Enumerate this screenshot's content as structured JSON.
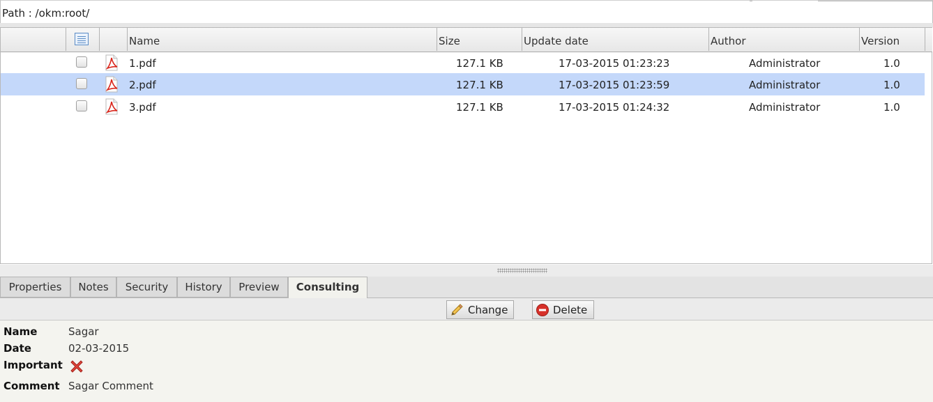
{
  "path": {
    "text": "Path : /okm:root/"
  },
  "columns": {
    "name": "Name",
    "size": "Size",
    "update_date": "Update date",
    "author": "Author",
    "version": "Version"
  },
  "icons": {
    "column_picker": "column-picker-icon",
    "pdf": "pdf-file-icon",
    "change": "pencil-icon",
    "delete": "delete-circle-icon",
    "important": "red-x-icon"
  },
  "files": [
    {
      "name": "1.pdf",
      "size": "127.1 KB",
      "date": "17-03-2015 01:23:23",
      "author": "Administrator",
      "version": "1.0",
      "selected": false
    },
    {
      "name": "2.pdf",
      "size": "127.1 KB",
      "date": "17-03-2015 01:23:59",
      "author": "Administrator",
      "version": "1.0",
      "selected": true
    },
    {
      "name": "3.pdf",
      "size": "127.1 KB",
      "date": "17-03-2015 01:24:32",
      "author": "Administrator",
      "version": "1.0",
      "selected": false
    }
  ],
  "tabs": [
    {
      "label": "Properties",
      "active": false
    },
    {
      "label": "Notes",
      "active": false
    },
    {
      "label": "Security",
      "active": false
    },
    {
      "label": "History",
      "active": false
    },
    {
      "label": "Preview",
      "active": false
    },
    {
      "label": "Consulting",
      "active": true
    }
  ],
  "toolbar": {
    "change_label": "Change",
    "delete_label": "Delete"
  },
  "detail": {
    "name_label": "Name",
    "name_value": "Sagar",
    "date_label": "Date",
    "date_value": "02-03-2015",
    "important_label": "Important",
    "important_value": false,
    "comment_label": "Comment",
    "comment_value": "Sagar Comment"
  },
  "colors": {
    "selected_row": "#c4d8fa",
    "pdf_red": "#d9261c",
    "delete_red": "#d7312a"
  }
}
